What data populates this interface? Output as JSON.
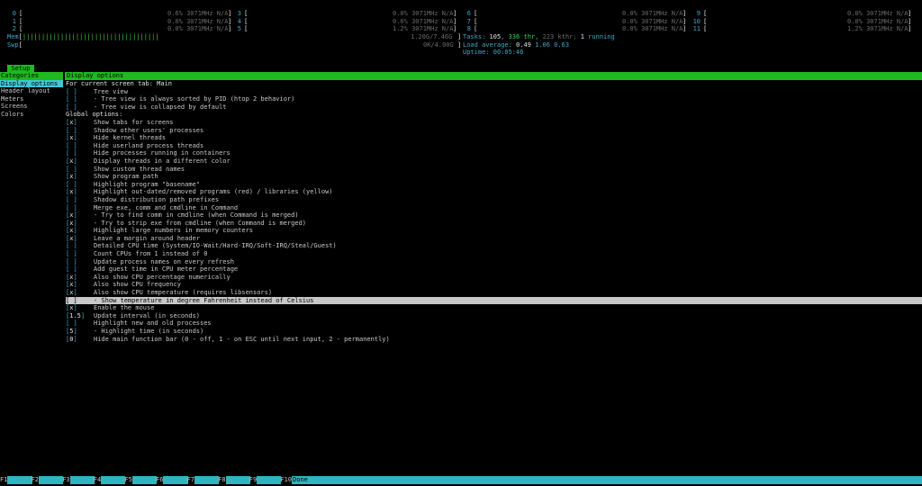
{
  "meters": {
    "cpus": [
      {
        "id": "0",
        "pct": "0.6%",
        "freq": "3071MHz",
        "temp": "N/A"
      },
      {
        "id": "1",
        "pct": "0.0%",
        "freq": "3071MHz",
        "temp": "N/A"
      },
      {
        "id": "2",
        "pct": "0.0%",
        "freq": "3071MHz",
        "temp": "N/A"
      },
      {
        "id": "3",
        "pct": "0.0%",
        "freq": "3071MHz",
        "temp": "N/A"
      },
      {
        "id": "4",
        "pct": "0.6%",
        "freq": "3071MHz",
        "temp": "N/A"
      },
      {
        "id": "5",
        "pct": "1.2%",
        "freq": "3071MHz",
        "temp": "N/A"
      },
      {
        "id": "6",
        "pct": "0.0%",
        "freq": "3071MHz",
        "temp": "N/A"
      },
      {
        "id": "7",
        "pct": "0.0%",
        "freq": "3071MHz",
        "temp": "N/A"
      },
      {
        "id": "8",
        "pct": "0.0%",
        "freq": "3071MHz",
        "temp": "N/A"
      },
      {
        "id": "9",
        "pct": "0.0%",
        "freq": "3071MHz",
        "temp": "N/A"
      },
      {
        "id": "10",
        "pct": "0.0%",
        "freq": "3071MHz",
        "temp": "N/A"
      },
      {
        "id": "11",
        "pct": "1.2%",
        "freq": "3071MHz",
        "temp": "N/A"
      }
    ],
    "mem": {
      "label": "Mem",
      "bar": "||||||||||||||||||||||||||||||||||||",
      "value": "1.20G/7.46G"
    },
    "swp": {
      "label": "Swp",
      "value": "0K/4.00G"
    },
    "tasks": {
      "label": "Tasks:",
      "count": "105",
      "sep": ",",
      "threads": "336",
      "thr_label": "thr,",
      "kthr": "223",
      "kthr_label": "kthr;",
      "running": "1",
      "running_label": "running"
    },
    "load": {
      "label": "Load average:",
      "l1": "0.49",
      "l5": "1.06",
      "l15": "0.63"
    },
    "uptime": {
      "label": "Uptime:",
      "value": "00:05:46"
    }
  },
  "setup_tab": "Setup",
  "panel_header": "Display options",
  "categories_header": "Categories",
  "categories": [
    "Display options",
    "Header layout",
    "Meters",
    "Screens",
    "Colors"
  ],
  "options": [
    {
      "type": "heading",
      "text": "For current screen tab: Main"
    },
    {
      "type": "check",
      "mark": " ",
      "text": "Tree view"
    },
    {
      "type": "check",
      "mark": " ",
      "text": "- Tree view is always sorted by PID (htop 2 behavior)"
    },
    {
      "type": "check",
      "mark": " ",
      "text": "- Tree view is collapsed by default"
    },
    {
      "type": "heading",
      "text": "Global options:"
    },
    {
      "type": "check",
      "mark": "x",
      "text": "Show tabs for screens"
    },
    {
      "type": "check",
      "mark": " ",
      "text": "Shadow other users' processes"
    },
    {
      "type": "check",
      "mark": "x",
      "text": "Hide kernel threads"
    },
    {
      "type": "check",
      "mark": " ",
      "text": "Hide userland process threads"
    },
    {
      "type": "check",
      "mark": " ",
      "text": "Hide processes running in containers"
    },
    {
      "type": "check",
      "mark": "x",
      "text": "Display threads in a different color"
    },
    {
      "type": "check",
      "mark": " ",
      "text": "Show custom thread names"
    },
    {
      "type": "check",
      "mark": "x",
      "text": "Show program path"
    },
    {
      "type": "check",
      "mark": " ",
      "text": "Highlight program \"basename\""
    },
    {
      "type": "check",
      "mark": "x",
      "text": "Highlight out-dated/removed programs (red) / libraries (yellow)"
    },
    {
      "type": "check",
      "mark": " ",
      "text": "Shadow distribution path prefixes"
    },
    {
      "type": "check",
      "mark": " ",
      "text": "Merge exe, comm and cmdline in Command"
    },
    {
      "type": "check",
      "mark": "x",
      "text": "- Try to find comm in cmdline (when Command is merged)"
    },
    {
      "type": "check",
      "mark": "x",
      "text": "- Try to strip exe from cmdline (when Command is merged)"
    },
    {
      "type": "check",
      "mark": "x",
      "text": "Highlight large numbers in memory counters"
    },
    {
      "type": "check",
      "mark": "x",
      "text": "Leave a margin around header"
    },
    {
      "type": "check",
      "mark": " ",
      "text": "Detailed CPU time (System/IO-Wait/Hard-IRQ/Soft-IRQ/Steal/Guest)"
    },
    {
      "type": "check",
      "mark": " ",
      "text": "Count CPUs from 1 instead of 0"
    },
    {
      "type": "check",
      "mark": " ",
      "text": "Update process names on every refresh"
    },
    {
      "type": "check",
      "mark": " ",
      "text": "Add guest time in CPU meter percentage"
    },
    {
      "type": "check",
      "mark": "x",
      "text": "Also show CPU percentage numerically"
    },
    {
      "type": "check",
      "mark": "x",
      "text": "Also show CPU frequency"
    },
    {
      "type": "check",
      "mark": "x",
      "text": "Also show CPU temperature (requires libsensors)"
    },
    {
      "type": "check",
      "mark": " ",
      "text": "- Show temperature in degree Fahrenheit instead of Celsius",
      "highlight": true
    },
    {
      "type": "check",
      "mark": "x",
      "text": "Enable the mouse"
    },
    {
      "type": "value",
      "mark": "1.5",
      "text": "Update interval (in seconds)"
    },
    {
      "type": "check",
      "mark": " ",
      "text": "Highlight new and old processes"
    },
    {
      "type": "value",
      "mark": "5",
      "text": "- Highlight time (in seconds)"
    },
    {
      "type": "value",
      "mark": "0",
      "text": "Hide main function bar (0 - off, 1 - on ESC until next input, 2 - permanently)"
    }
  ],
  "function_keys": [
    {
      "key": "F1",
      "label": ""
    },
    {
      "key": "F2",
      "label": ""
    },
    {
      "key": "F3",
      "label": ""
    },
    {
      "key": "F4",
      "label": ""
    },
    {
      "key": "F5",
      "label": ""
    },
    {
      "key": "F6",
      "label": ""
    },
    {
      "key": "F7",
      "label": ""
    },
    {
      "key": "F8",
      "label": ""
    },
    {
      "key": "F9",
      "label": ""
    },
    {
      "key": "F10",
      "label": "Done"
    }
  ]
}
